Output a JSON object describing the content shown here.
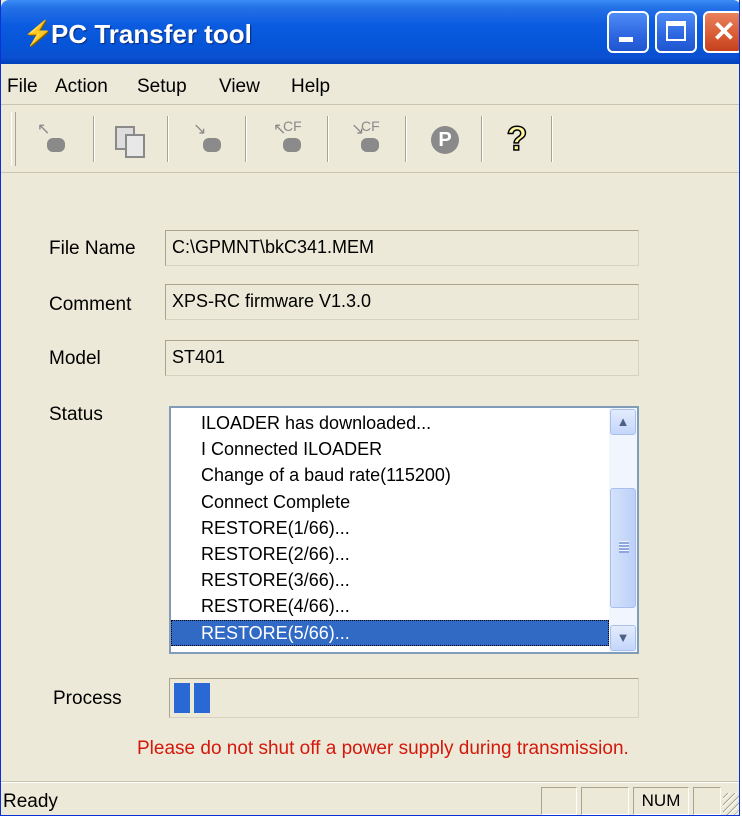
{
  "window": {
    "title": "PC Transfer tool",
    "close_glyph": "✕",
    "icon": "lightning-icon"
  },
  "menu": [
    {
      "label": "File"
    },
    {
      "label": "Action"
    },
    {
      "label": "Setup"
    },
    {
      "label": "View"
    },
    {
      "label": "Help"
    }
  ],
  "toolbar": {
    "cf_label": "CF",
    "p_label": "P",
    "help_glyph": "?",
    "tools": [
      "download-icon",
      "copy-icon",
      "upload-icon",
      "download-cf-icon",
      "upload-cf-icon",
      "p-icon",
      "help-icon"
    ]
  },
  "form": {
    "file_name_label": "File Name",
    "file_name_value": "C:\\GPMNT\\bkC341.MEM",
    "comment_label": "Comment",
    "comment_value": "XPS-RC firmware V1.3.0",
    "model_label": "Model",
    "model_value": "ST401",
    "status_label": "Status",
    "process_label": "Process"
  },
  "status_list": {
    "items": [
      "ILOADER has downloaded...",
      "I Connected ILOADER",
      "Change of a baud rate(115200)",
      "Connect Complete",
      "RESTORE(1/66)...",
      "RESTORE(2/66)...",
      "RESTORE(3/66)...",
      "RESTORE(4/66)...",
      "RESTORE(5/66)..."
    ],
    "selected_index": 8
  },
  "progress": {
    "filled_blocks": 2
  },
  "warning": "Please do not shut off a power supply during transmission.",
  "statusbar": {
    "text": "Ready",
    "num": "NUM"
  },
  "colors": {
    "titlebar": "#0655d8",
    "selection": "#316ac5",
    "progress": "#2a68d4",
    "warning": "#d4180c"
  }
}
